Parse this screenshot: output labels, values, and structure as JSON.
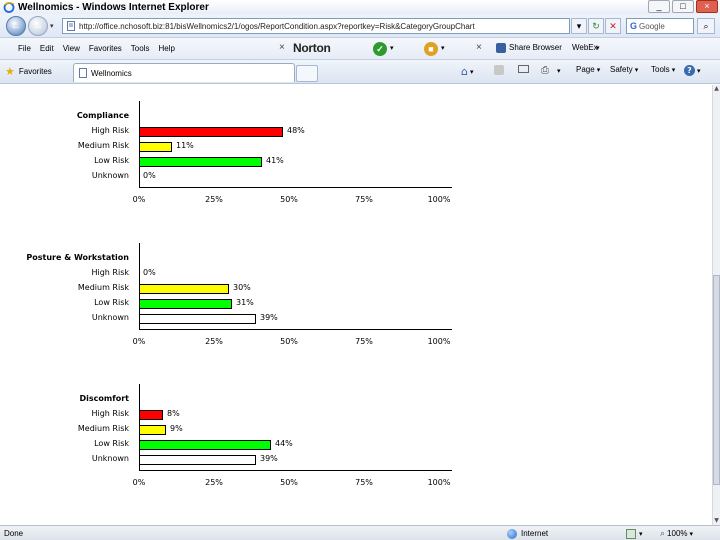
{
  "window": {
    "title": "Wellnomics - Windows Internet Explorer",
    "minimize": "_",
    "maximize": "□",
    "close": "×"
  },
  "address_bar": {
    "url": "http://office.nchosoft.biz:81/bisWellnomics2/1/ogos/ReportCondition.aspx?reportkey=Risk&CategoryGroupChart",
    "refresh": "↻",
    "stop": "✕",
    "search_placeholder": "Google",
    "search_brand": "G"
  },
  "menu": {
    "items": [
      "File",
      "Edit",
      "View",
      "Favorites",
      "Tools",
      "Help"
    ],
    "norton_label": "Norton",
    "norton_close": "×",
    "share_label": "Share Browser",
    "webex_label": "WebEx",
    "share_close": "×"
  },
  "favorites_bar": {
    "favorites_label": "Favorites",
    "tab_label": "Wellnomics",
    "page_label": "Page",
    "safety_label": "Safety",
    "tools_label": "Tools",
    "help_icon": "?"
  },
  "status_bar": {
    "left_text": "Done",
    "zone": "Internet",
    "zoom": "100%"
  },
  "colors": {
    "high": "#ff0000",
    "medium": "#ffff00",
    "low": "#00ff00",
    "unknown": "#ffffff"
  },
  "chart_data": [
    {
      "type": "bar",
      "orientation": "horizontal",
      "title": "Compliance",
      "categories": [
        "High Risk",
        "Medium Risk",
        "Low Risk",
        "Unknown"
      ],
      "values": [
        48,
        11,
        41,
        0
      ],
      "value_labels": [
        "48%",
        "11%",
        "41%",
        "0%"
      ],
      "colors": [
        "#ff0000",
        "#ffff00",
        "#00ff00",
        "#ffffff"
      ],
      "xlim": [
        0,
        100
      ],
      "xticks": [
        "0%",
        "25%",
        "50%",
        "75%",
        "100%"
      ],
      "grid": false
    },
    {
      "type": "bar",
      "orientation": "horizontal",
      "title": "Posture & Workstation",
      "categories": [
        "High Risk",
        "Medium Risk",
        "Low Risk",
        "Unknown"
      ],
      "values": [
        0,
        30,
        31,
        39
      ],
      "value_labels": [
        "0%",
        "30%",
        "31%",
        "39%"
      ],
      "colors": [
        "#ff0000",
        "#ffff00",
        "#00ff00",
        "#ffffff"
      ],
      "xlim": [
        0,
        100
      ],
      "xticks": [
        "0%",
        "25%",
        "50%",
        "75%",
        "100%"
      ],
      "grid": false
    },
    {
      "type": "bar",
      "orientation": "horizontal",
      "title": "Discomfort",
      "categories": [
        "High Risk",
        "Medium Risk",
        "Low Risk",
        "Unknown"
      ],
      "values": [
        8,
        9,
        44,
        39
      ],
      "value_labels": [
        "8%",
        "9%",
        "44%",
        "39%"
      ],
      "colors": [
        "#ff0000",
        "#ffff00",
        "#00ff00",
        "#ffffff"
      ],
      "xlim": [
        0,
        100
      ],
      "xticks": [
        "0%",
        "25%",
        "50%",
        "75%",
        "100%"
      ],
      "grid": false
    }
  ]
}
